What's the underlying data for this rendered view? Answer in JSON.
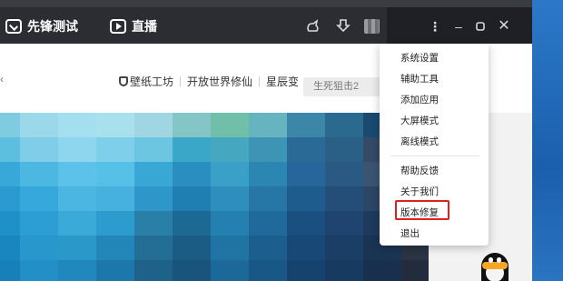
{
  "titlebar": {
    "tabs": [
      {
        "label": "先锋测试",
        "icon": "shield-check-icon"
      },
      {
        "label": "直播",
        "icon": "play-icon"
      }
    ],
    "icons": [
      "bird-icon",
      "download-icon",
      "avatar-icon",
      "more-icon",
      "minimize-icon",
      "maximize-icon",
      "close-icon"
    ]
  },
  "nav": {
    "links": [
      "壁纸工坊",
      "开放世界修仙",
      "星辰变"
    ],
    "search_placeholder": "生死狙击2"
  },
  "menu": {
    "group1": [
      "系统设置",
      "辅助工具",
      "添加应用",
      "大屏模式",
      "离线模式"
    ],
    "group2": [
      "帮助反馈",
      "关于我们",
      "版本修复",
      "退出"
    ],
    "highlighted": "版本修复"
  },
  "colors": {
    "titlebar": "#2b2d33",
    "highlight_border": "#e0201c"
  }
}
